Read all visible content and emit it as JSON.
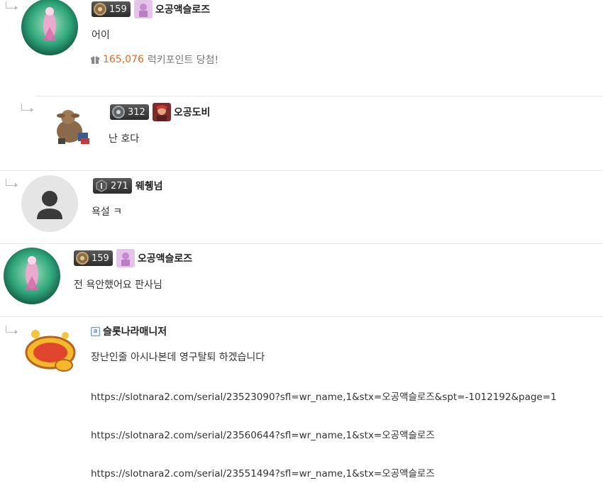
{
  "comments": [
    {
      "nickname": "오공액슬로즈",
      "level": "159",
      "content": "어이",
      "point_value": "165,076",
      "point_text": "럭키포인트 당첨!"
    },
    {
      "nickname": "오공도비",
      "level": "312",
      "content": "난 호다"
    },
    {
      "nickname": "웨췡넘",
      "level": "271",
      "content": "욕설 ㅋ"
    },
    {
      "nickname": "오공액슬로즈",
      "level": "159",
      "content": "전 욕안했어요 판사님"
    },
    {
      "nickname": "슬롯나라매니저",
      "admin_icon": "a",
      "content": "장난인줄 아시나본데 영구탈퇴 하겠습니다",
      "links": [
        "https://slotnara2.com/serial/23523090?sfl=wr_name,1&stx=오공액슬로즈&spt=-1012192&page=1",
        "https://slotnara2.com/serial/23560644?sfl=wr_name,1&stx=오공액슬로즈",
        "https://slotnara2.com/serial/23551494?sfl=wr_name,1&stx=오공액슬로즈"
      ]
    }
  ],
  "icons": {
    "reply": "reply-arrow-icon",
    "gift": "gift-icon",
    "level": "level-emblem-icon",
    "admin": "admin-icon",
    "default_avatar": "user-icon"
  },
  "colors": {
    "point_value": "#e06b1f",
    "divider": "#e6e6e6",
    "level_badge": "#3a3a3a"
  }
}
